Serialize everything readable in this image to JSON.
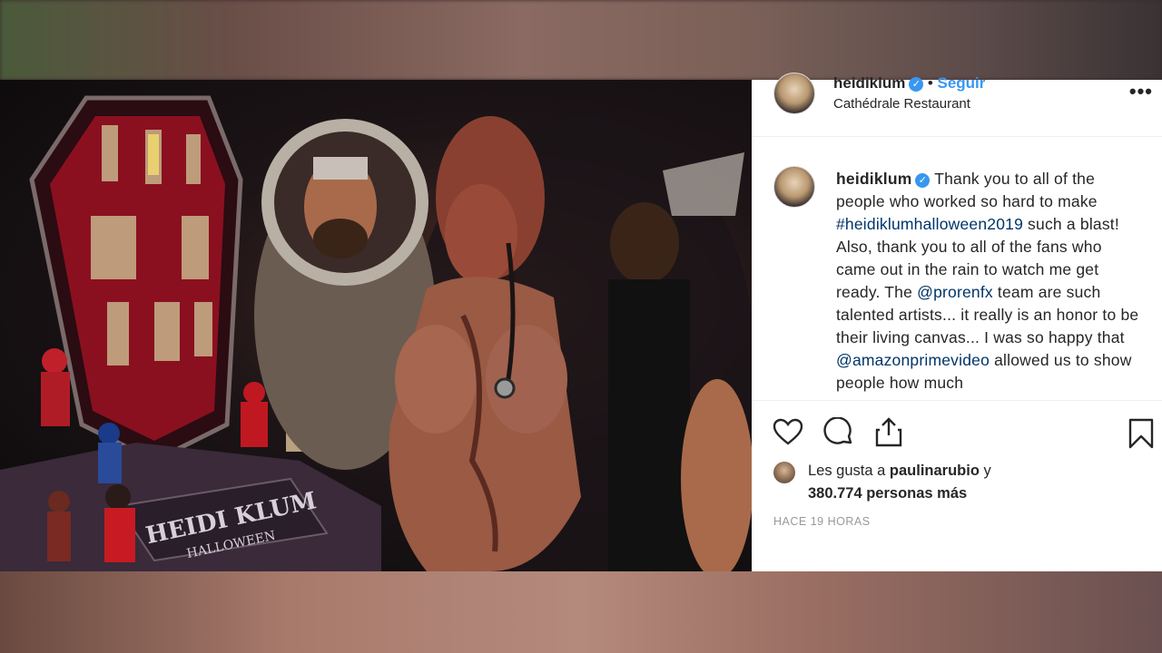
{
  "post": {
    "username": "heidiklum",
    "follow_label": "Seguir",
    "location": "Cathédrale Restaurant",
    "caption": {
      "text_1": " Thank you to all of the people who worked so hard to make ",
      "hashtag": "#heidiklumhalloween2019",
      "text_2": " such a blast! Also, thank you to all of the fans who came out in the rain to watch me get ready. The ",
      "mention_1": "@prorenfx",
      "text_3": " team are such talented artists... it really is an honor to be their living canvas... I was so happy that ",
      "mention_2": "@amazonprimevideo",
      "text_4": " allowed us to show people how much"
    },
    "likes": {
      "prefix": "Les gusta a ",
      "user": "paulinarubio",
      "suffix": " y",
      "count_text": "380.774 personas más"
    },
    "timestamp": "HACE 19 HORAS",
    "photo_sign_text": "HEIDI KLUM HALLOWEEN"
  },
  "colors": {
    "accent": "#3897f0",
    "link": "#003569",
    "text": "#262626",
    "muted": "#999999"
  },
  "icons": [
    "heart-icon",
    "comment-icon",
    "share-icon",
    "bookmark-icon",
    "more-options-icon",
    "verified-icon",
    "user-profile-icon"
  ]
}
